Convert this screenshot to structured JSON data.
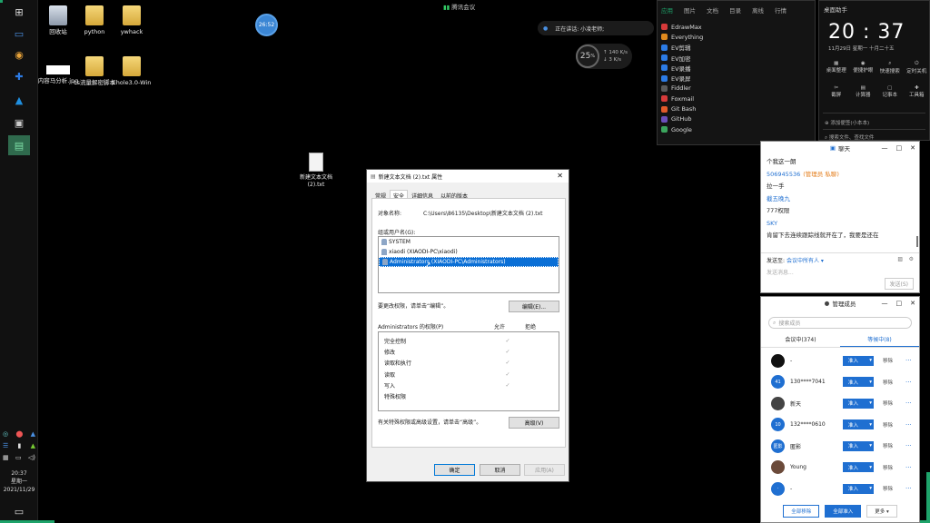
{
  "desktop_icons": [
    {
      "label": "回收站"
    },
    {
      "label": "python"
    },
    {
      "label": "ywhack"
    },
    {
      "label": "内容马分析.jpg"
    },
    {
      "label": "cs流量解密脚本"
    },
    {
      "label": "Ehole3.0-Win"
    }
  ],
  "desktop_file": {
    "label": "新建文本文档 (2).txt"
  },
  "cpu_bubble": {
    "text": "26:52"
  },
  "meeting_label": "腾讯会议",
  "mic_bar": {
    "text": "正在讲话: 小凌老师;"
  },
  "net_widget": {
    "percent": "25",
    "unit": "%",
    "up": "140",
    "up_unit": "K/s",
    "down": "3",
    "down_unit": "K/s"
  },
  "apps_panel": {
    "tabs": [
      "应用",
      "图片",
      "文档",
      "目录",
      "离线",
      "行情"
    ],
    "items": [
      {
        "label": "EdrawMax",
        "color": "#d63a3a"
      },
      {
        "label": "Everything",
        "color": "#e08a1e"
      },
      {
        "label": "EV剪辑",
        "color": "#2c7be5"
      },
      {
        "label": "EV加密",
        "color": "#2c7be5"
      },
      {
        "label": "EV录播",
        "color": "#2c7be5"
      },
      {
        "label": "EV录屏",
        "color": "#2c7be5"
      },
      {
        "label": "Fiddler",
        "color": "#5a5a5a"
      },
      {
        "label": "Foxmail",
        "color": "#d63a3a"
      },
      {
        "label": "Git Bash",
        "color": "#e05a2b"
      },
      {
        "label": "GitHub",
        "color": "#6b4fbb"
      },
      {
        "label": "Google",
        "color": "#3ba55d"
      }
    ]
  },
  "clock_panel": {
    "title": "桌面助手",
    "time": "20 : 37",
    "date": "11月29日  星期一  十月二十五",
    "tools": [
      "桌面整理",
      "便捷护眼",
      "快速搜索",
      "定时关机",
      "截屏",
      "计算器",
      "记事本",
      "工具箱"
    ],
    "note1": "添加便签(小本本)",
    "note2": "搜索文件、查找文件"
  },
  "chat_panel": {
    "title": "聊天",
    "messages": [
      {
        "text": "个我这一朗",
        "style": "plain"
      },
      {
        "text": "506945536",
        "style": "blue",
        "suffix": "(管理员 私聊)"
      },
      {
        "text": "拉一手",
        "style": "plain"
      },
      {
        "text": "截五晚九",
        "style": "blue",
        "suffix": ""
      },
      {
        "text": "777权限",
        "style": "plain"
      },
      {
        "text": "SKY",
        "style": "blue",
        "suffix": ""
      },
      {
        "text": "肯留下去连续跟踪线就开在了，我要是还在",
        "style": "plain"
      }
    ],
    "send_to_label": "发送至:",
    "send_to_value": "会议中所有人",
    "input_placeholder": "发送消息...",
    "send_label": "发送(S)"
  },
  "members_panel": {
    "title": "管理成员",
    "search_placeholder": "搜索成员",
    "tab_in": "会议中(374)",
    "tab_wait": "等候中(8)",
    "admit_label": "准入",
    "remove_label": "移除",
    "members": [
      {
        "name": "-",
        "avatar": "",
        "color": "#111111"
      },
      {
        "name": "130****7041",
        "avatar": "41",
        "color": "#1f6fd1"
      },
      {
        "name": "新天",
        "avatar": "",
        "color": "#444444"
      },
      {
        "name": "132****0610",
        "avatar": "10",
        "color": "#1f6fd1"
      },
      {
        "name": "匿影",
        "avatar": "匿影",
        "color": "#1f6fd1"
      },
      {
        "name": "Young",
        "avatar": "",
        "color": "#6b4a3a"
      },
      {
        "name": "-",
        "avatar": "·",
        "color": "#1f6fd1"
      }
    ],
    "btn_remove_all": "全部移除",
    "btn_admit_all": "全部准入",
    "btn_more": "更多"
  },
  "dialog": {
    "title": "新建文本文档 (2).txt 属性",
    "tabs": [
      "常规",
      "安全",
      "详细信息",
      "以前的版本"
    ],
    "object_label": "对象名称:",
    "object_value": "C:\\Users\\86135\\Desktop\\新建文本文档 (2).txt",
    "group_label": "组或用户名(G):",
    "users": [
      "SYSTEM",
      "xiaodi (XIAODI-PC\\xiaodi)",
      "Administrators (XIAODI-PC\\Administrators)"
    ],
    "edit_hint": "要更改权限，请单击“编辑”。",
    "edit_btn": "编辑(E)...",
    "perm_header": "Administrators 的权限(P)",
    "allow": "允许",
    "deny": "拒绝",
    "permissions": [
      {
        "name": "完全控制",
        "allow": "✓"
      },
      {
        "name": "修改",
        "allow": "✓"
      },
      {
        "name": "读取和执行",
        "allow": "✓"
      },
      {
        "name": "读取",
        "allow": "✓"
      },
      {
        "name": "写入",
        "allow": "✓"
      },
      {
        "name": "特殊权限",
        "allow": ""
      }
    ],
    "advanced_hint": "有关特殊权限或高级设置，请单击“高级”。",
    "advanced_btn": "高级(V)",
    "ok": "确定",
    "cancel": "取消",
    "apply": "应用(A)"
  },
  "taskbar": {
    "time": "20:37",
    "weekday": "星期一",
    "date": "2021/11/29"
  }
}
